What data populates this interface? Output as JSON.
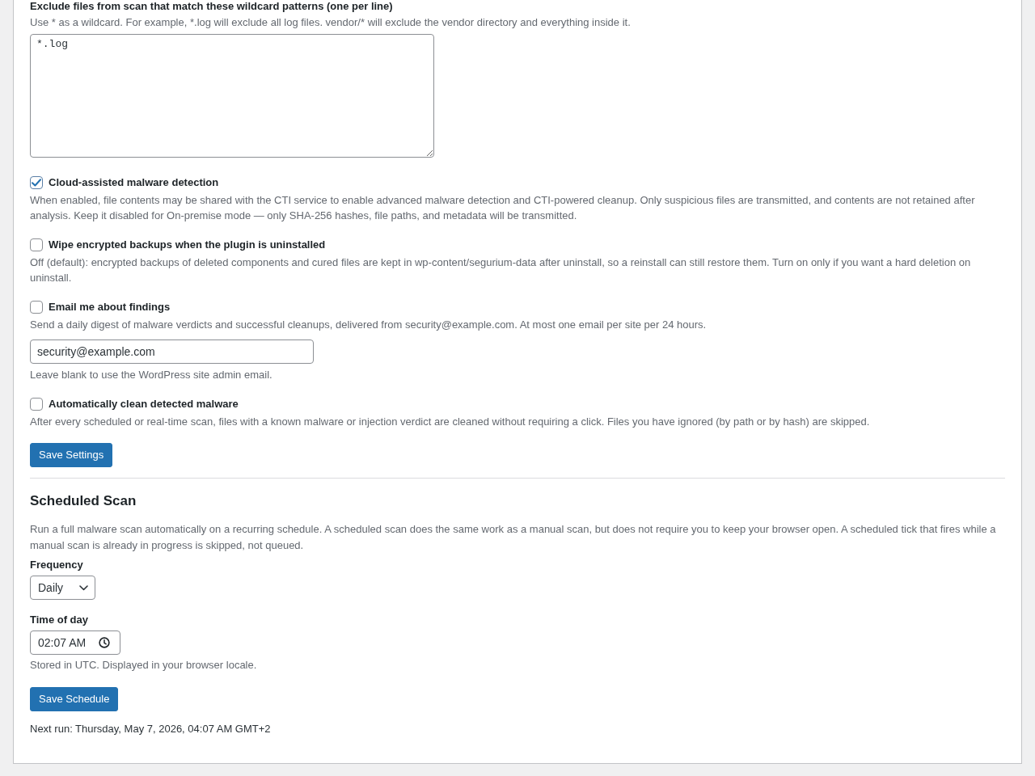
{
  "exclusions": {
    "label": "Exclude files from scan that match these wildcard patterns (one per line)",
    "help": "Use * as a wildcard. For example, *.log will exclude all log files. vendor/* will exclude the vendor directory and everything inside it.",
    "value": "*.log"
  },
  "options": [
    {
      "label": "Cloud-assisted malware detection",
      "checked": true,
      "description": "When enabled, file contents may be shared with the CTI service to enable advanced malware detection and CTI-powered cleanup. Only suspicious files are transmitted, and contents are not retained after analysis. Keep it disabled for On-premise mode — only SHA-256 hashes, file paths, and metadata will be transmitted."
    },
    {
      "label": "Wipe encrypted backups when the plugin is uninstalled",
      "checked": false,
      "description": "Off (default): encrypted backups of deleted components and cured files are kept in wp-content/segurium-data after uninstall, so a reinstall can still restore them. Turn on only if you want a hard deletion on uninstall."
    },
    {
      "label": "Email me about findings",
      "checked": false,
      "description": "Send a daily digest of malware verdicts and successful cleanups, delivered from security@example.com. At most one email per site per 24 hours.",
      "email_field": {
        "value": "security@example.com",
        "hint": "Leave blank to use the WordPress site admin email."
      }
    },
    {
      "label": "Automatically clean detected malware",
      "checked": false,
      "description": "After every scheduled or real-time scan, files with a known malware or injection verdict are cleaned without requiring a click. Files you have ignored (by path or by hash) are skipped."
    }
  ],
  "save_settings_button": "Save Settings",
  "scheduled_scan": {
    "title": "Scheduled Scan",
    "description": "Run a full malware scan automatically on a recurring schedule. A scheduled scan does the same work as a manual scan, but does not require you to keep your browser open. A scheduled tick that fires while a manual scan is already in progress is skipped, not queued.",
    "frequency": {
      "label": "Frequency",
      "value": "Daily"
    },
    "time_of_day": {
      "label": "Time of day",
      "value": "02:07 AM",
      "hint": "Stored in UTC. Displayed in your browser locale."
    },
    "save_button": "Save Schedule",
    "next_run": "Next run: Thursday, May 7, 2026, 04:07 AM GMT+2"
  }
}
